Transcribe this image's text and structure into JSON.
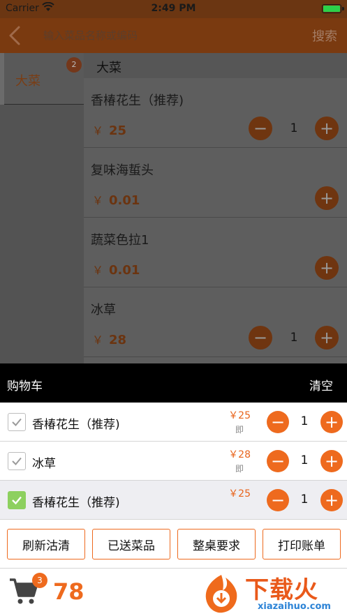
{
  "status_bar": {
    "carrier": "Carrier",
    "time": "2:49 PM"
  },
  "nav": {
    "search_placeholder": "输入菜品名称或编码",
    "search_label": "搜索"
  },
  "sidebar": {
    "categories": [
      {
        "label": "大菜",
        "badge": "2"
      }
    ]
  },
  "dish_list": {
    "section_title": "大菜",
    "currency": "￥",
    "dishes": [
      {
        "name": "香椿花生（推荐)",
        "price": "25",
        "qty": "1"
      },
      {
        "name": "复味海蜇头",
        "price": "0.01"
      },
      {
        "name": "蔬菜色拉1",
        "price": "0.01"
      },
      {
        "name": "冰草",
        "price": "28",
        "qty": "1"
      }
    ]
  },
  "cart": {
    "title": "购物车",
    "clear_label": "清空",
    "items": [
      {
        "name": "香椿花生（推荐)",
        "price": "￥25",
        "note": "即",
        "qty": "1"
      },
      {
        "name": "冰草",
        "price": "￥28",
        "note": "即",
        "qty": "1"
      },
      {
        "name": "香椿花生（推荐)",
        "price": "￥25",
        "qty": "1"
      }
    ],
    "actions": [
      "刷新沽清",
      "已送菜品",
      "整桌要求",
      "打印账单"
    ],
    "count_badge": "3",
    "total": "78"
  },
  "watermark": {
    "text": "下载火",
    "url": "xiazaihuo.com"
  },
  "colors": {
    "accent": "#ee6a1e",
    "overlay_header": "#000000",
    "checked": "#8dd05f"
  }
}
